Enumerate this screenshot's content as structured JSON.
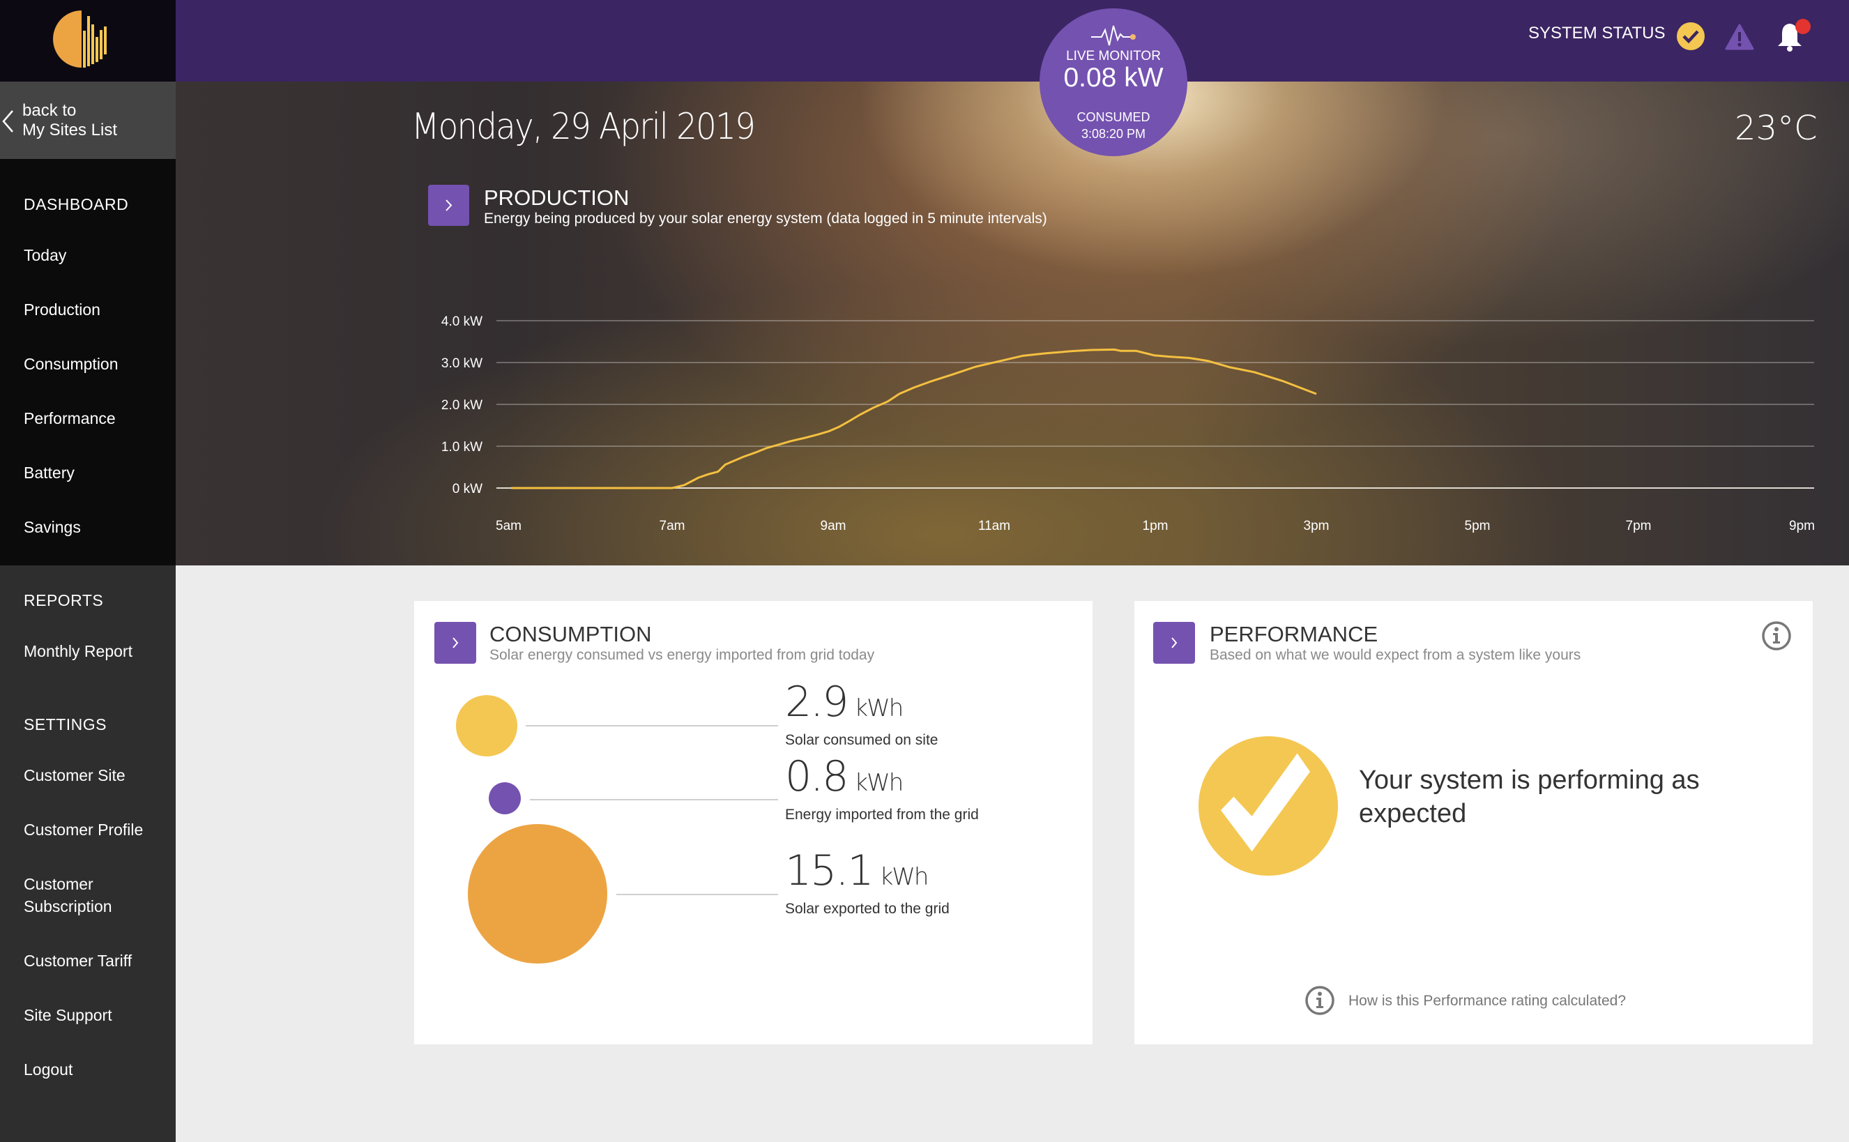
{
  "app": {
    "logo": "solar-logo",
    "back_link": {
      "line1": "back to",
      "line2": "My Sites List"
    }
  },
  "sidebar": {
    "sections": [
      {
        "heading": "DASHBOARD",
        "items": [
          "Today",
          "Production",
          "Consumption",
          "Performance",
          "Battery",
          "Savings"
        ]
      },
      {
        "heading": "REPORTS",
        "items": [
          "Monthly Report"
        ]
      },
      {
        "heading": "SETTINGS",
        "items": [
          "Customer Site",
          "Customer Profile",
          "Customer Subscription",
          "Customer Tariff",
          "Site Support",
          "Logout"
        ]
      }
    ]
  },
  "header": {
    "system_status_label": "SYSTEM STATUS",
    "status_icons": [
      "check-circle-icon",
      "warning-icon",
      "bell-icon"
    ],
    "notification_dot": true,
    "colors": {
      "bar": "#3b2563",
      "accent": "#7452b0",
      "status_ok": "#f4c752",
      "alert_dot": "#e3342f"
    }
  },
  "live_monitor": {
    "label": "LIVE MONITOR",
    "value": "0.08 kW",
    "status": "CONSUMED",
    "time": "3:08:20 PM",
    "icon": "pulse-icon"
  },
  "hero": {
    "date": "Monday, 29 April 2019",
    "temperature": "23°C"
  },
  "production": {
    "title": "PRODUCTION",
    "subtitle": "Energy being produced by your solar energy system (data logged in 5 minute intervals)"
  },
  "chart_data": {
    "type": "line",
    "title": "PRODUCTION",
    "xlabel": "",
    "ylabel": "",
    "x_unit": "hour of day",
    "xlim": [
      5,
      21
    ],
    "ylim": [
      0,
      4
    ],
    "grid": true,
    "legend": "none",
    "y_ticks": [
      0,
      1,
      2,
      3,
      4
    ],
    "y_tick_labels": [
      "0 kW",
      "1.0 kW",
      "2.0 kW",
      "3.0 kW",
      "4.0 kW"
    ],
    "x_ticks": [
      5,
      7,
      9,
      11,
      13,
      15,
      17,
      19,
      21
    ],
    "x_tick_labels": [
      "5am",
      "7am",
      "9am",
      "11am",
      "1pm",
      "3pm",
      "5pm",
      "7pm",
      "9pm"
    ],
    "series": [
      {
        "name": "Production (kW)",
        "color": "#f4c040",
        "x": [
          5.0,
          6.0,
          7.0,
          7.15,
          7.33,
          7.45,
          7.57,
          7.66,
          7.78,
          7.89,
          8.05,
          8.18,
          8.33,
          8.47,
          8.65,
          8.81,
          8.95,
          9.07,
          9.2,
          9.33,
          9.51,
          9.68,
          9.82,
          10.0,
          10.2,
          10.49,
          10.77,
          11.06,
          11.35,
          11.64,
          11.95,
          12.2,
          12.49,
          12.57,
          12.76,
          12.99,
          13.18,
          13.42,
          13.65,
          13.92,
          14.23,
          14.58,
          15.0
        ],
        "y": [
          0.0,
          0.0,
          0.0,
          0.07,
          0.25,
          0.33,
          0.39,
          0.56,
          0.66,
          0.75,
          0.86,
          0.96,
          1.04,
          1.12,
          1.2,
          1.28,
          1.36,
          1.46,
          1.6,
          1.75,
          1.93,
          2.07,
          2.25,
          2.4,
          2.54,
          2.72,
          2.9,
          3.03,
          3.16,
          3.22,
          3.27,
          3.3,
          3.31,
          3.28,
          3.28,
          3.17,
          3.14,
          3.11,
          3.04,
          2.89,
          2.77,
          2.56,
          2.25
        ]
      }
    ]
  },
  "consumption": {
    "title": "CONSUMPTION",
    "subtitle": "Solar energy consumed vs energy imported from grid today",
    "metrics": [
      {
        "value": "2.9",
        "unit": "kWh",
        "label": "Solar consumed on site",
        "color": "#f4c752"
      },
      {
        "value": "0.8",
        "unit": "kWh",
        "label": "Energy imported from the grid",
        "color": "#7452b0"
      },
      {
        "value": "15.1",
        "unit": "kWh",
        "label": "Solar exported to the grid",
        "color": "#eca443"
      }
    ]
  },
  "performance": {
    "title": "PERFORMANCE",
    "subtitle": "Based on what we would expect from a system like yours",
    "message": "Your system is performing as expected",
    "help_link": "How is this Performance rating calculated?",
    "status_color": "#f4c752"
  }
}
